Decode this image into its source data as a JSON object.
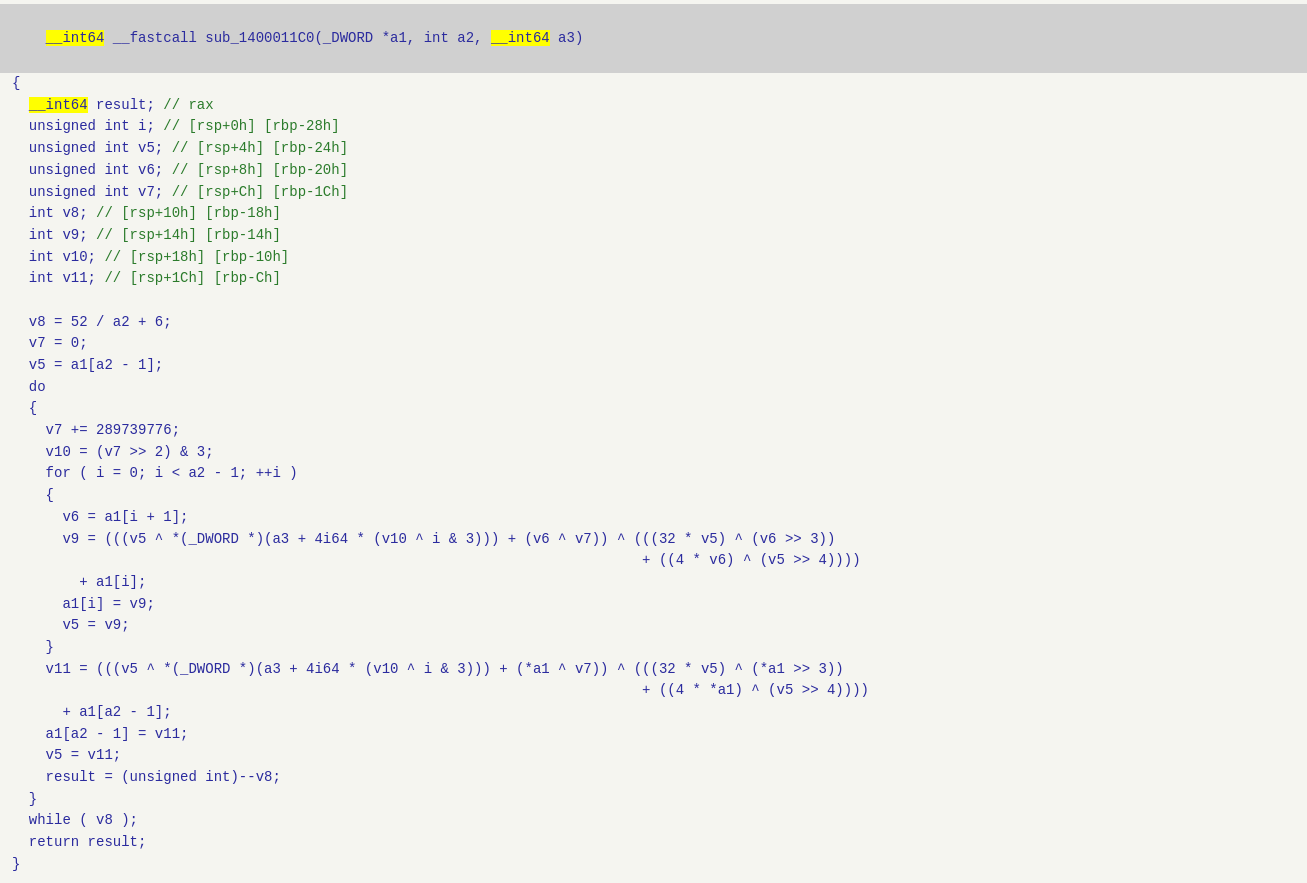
{
  "header": {
    "text": " __int64 __fastcall sub_1400011C0(_DWORD *a1, int a2, __int64 a3)"
  },
  "lines": [
    {
      "id": "l1",
      "type": "brace",
      "text": "{"
    },
    {
      "id": "l2",
      "type": "decl_highlight",
      "pre": "  ",
      "highlight": "__int64",
      "post": " result; ",
      "comment": "// rax"
    },
    {
      "id": "l3",
      "type": "decl",
      "text": "  unsigned int i; ",
      "comment": "// [rsp+0h] [rbp-28h]"
    },
    {
      "id": "l4",
      "type": "decl",
      "text": "  unsigned int v5; ",
      "comment": "// [rsp+4h] [rbp-24h]"
    },
    {
      "id": "l5",
      "type": "decl",
      "text": "  unsigned int v6; ",
      "comment": "// [rsp+8h] [rbp-20h]"
    },
    {
      "id": "l6",
      "type": "decl",
      "text": "  unsigned int v7; ",
      "comment": "// [rsp+Ch] [rbp-1Ch]"
    },
    {
      "id": "l7",
      "type": "decl",
      "text": "  int v8; ",
      "comment": "// [rsp+10h] [rbp-18h]"
    },
    {
      "id": "l8",
      "type": "decl",
      "text": "  int v9; ",
      "comment": "// [rsp+14h] [rbp-14h]"
    },
    {
      "id": "l9",
      "type": "decl",
      "text": "  int v10; ",
      "comment": "// [rsp+18h] [rbp-10h]"
    },
    {
      "id": "l10",
      "type": "decl",
      "text": "  int v11; ",
      "comment": "// [rsp+1Ch] [rbp-Ch]"
    },
    {
      "id": "l11",
      "type": "empty"
    },
    {
      "id": "l12",
      "type": "code",
      "text": "  v8 = 52 / a2 + 6;"
    },
    {
      "id": "l13",
      "type": "code",
      "text": "  v7 = 0;"
    },
    {
      "id": "l14",
      "type": "code",
      "text": "  v5 = a1[a2 - 1];"
    },
    {
      "id": "l15",
      "type": "code",
      "text": "  do"
    },
    {
      "id": "l16",
      "type": "code",
      "text": "  {"
    },
    {
      "id": "l17",
      "type": "code",
      "text": "    v7 += 289739776;"
    },
    {
      "id": "l18",
      "type": "code",
      "text": "    v10 = (v7 >> 2) & 3;"
    },
    {
      "id": "l19",
      "type": "code",
      "text": "    for ( i = 0; i < a2 - 1; ++i )"
    },
    {
      "id": "l20",
      "type": "code",
      "text": "    {"
    },
    {
      "id": "l21",
      "type": "code",
      "text": "      v6 = a1[i + 1];"
    },
    {
      "id": "l22",
      "type": "code",
      "text": "      v9 = (((v5 ^ *(_DWORD *)(a3 + 4i64 * (v10 ^ i & 3))) + (v6 ^ v7)) ^ (((32 * v5) ^ (v6 >> 3))"
    },
    {
      "id": "l23",
      "type": "code",
      "text": "                                                                           + ((4 * v6) ^ (v5 >> 4))))"
    },
    {
      "id": "l24",
      "type": "code",
      "text": "        + a1[i];"
    },
    {
      "id": "l25",
      "type": "code",
      "text": "      a1[i] = v9;"
    },
    {
      "id": "l26",
      "type": "code",
      "text": "      v5 = v9;"
    },
    {
      "id": "l27",
      "type": "code",
      "text": "    }"
    },
    {
      "id": "l28",
      "type": "code",
      "text": "    v11 = (((v5 ^ *(_DWORD *)(a3 + 4i64 * (v10 ^ i & 3))) + (*a1 ^ v7)) ^ (((32 * v5) ^ (*a1 >> 3))"
    },
    {
      "id": "l29",
      "type": "code",
      "text": "                                                                           + ((4 * *a1) ^ (v5 >> 4))))"
    },
    {
      "id": "l30",
      "type": "code",
      "text": "      + a1[a2 - 1];"
    },
    {
      "id": "l31",
      "type": "code",
      "text": "    a1[a2 - 1] = v11;"
    },
    {
      "id": "l32",
      "type": "code",
      "text": "    v5 = v11;"
    },
    {
      "id": "l33",
      "type": "code",
      "text": "    result = (unsigned int)--v8;"
    },
    {
      "id": "l34",
      "type": "code",
      "text": "  }"
    },
    {
      "id": "l35",
      "type": "code",
      "text": "  while ( v8 );"
    },
    {
      "id": "l36",
      "type": "code",
      "text": "  return result;"
    },
    {
      "id": "l37",
      "type": "brace",
      "text": "}"
    }
  ],
  "colors": {
    "background": "#f5f5f0",
    "header_bg": "#d0d0d0",
    "code_color": "#2b2b9e",
    "comment_color": "#2b7b2b",
    "highlight_bg": "#ffff00"
  }
}
